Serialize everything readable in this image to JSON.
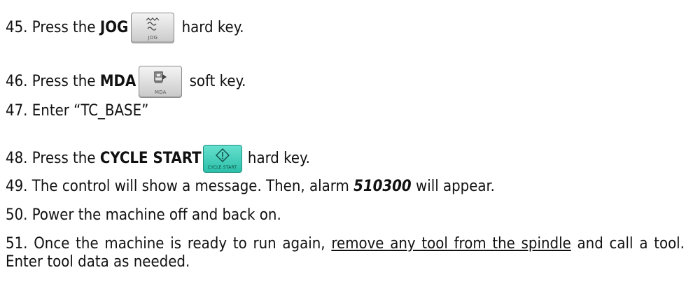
{
  "steps": [
    {
      "num": "45.",
      "pre": "Press the",
      "key": "JOG",
      "post": "hard key.",
      "icon": "jog-key-icon",
      "icon_label": "JOG"
    },
    {
      "num": "46.",
      "pre": "Press the",
      "key": "MDA",
      "post": "soft key.",
      "icon": "mda-key-icon",
      "icon_label": "MDA"
    },
    {
      "num": "47.",
      "text": "Enter “TC_BASE”"
    },
    {
      "num": "48.",
      "pre": "Press the",
      "key": "CYCLE START",
      "post": "hard key.",
      "icon": "cycle-start-key-icon",
      "icon_label": "CYCLE START",
      "icon_color": "#3fcfb9"
    },
    {
      "num": "49.",
      "pre": "The control will show a message. Then, alarm",
      "alarm": "510300",
      "post": "will appear."
    },
    {
      "num": "50.",
      "text": "Power the machine off and back on."
    },
    {
      "num": "51.",
      "pre": "Once the machine is ready to run again,",
      "underlined": "remove any tool from the spindle",
      "post": "and call a tool. Enter tool data as needed."
    }
  ]
}
